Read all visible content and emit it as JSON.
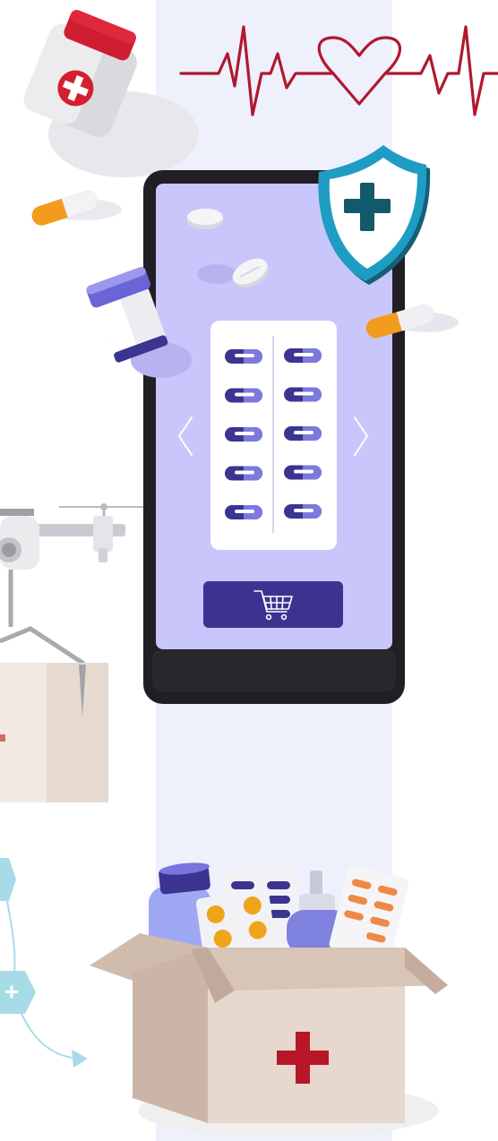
{
  "illustration": {
    "palette": {
      "background": "#ffffff",
      "column": "#eef0fc",
      "phone_body": "#211f23",
      "screen": "#c9c6fb",
      "pill_dark": "#3b3491",
      "pill_light": "#7c79dd",
      "cart_button": "#3c3290",
      "shield_outer": "#1f9cc4",
      "shield_cross": "#125a6b",
      "heartbeat": "#b0182e",
      "red_cross": "#b81629",
      "capsule_orange": "#f39b1f",
      "box_light": "#e6d8cd",
      "box_dark": "#cbb5a6",
      "hexagon": "#a8dbe8"
    },
    "icons": [
      "pill-jar-icon",
      "heartbeat-line-icon",
      "heart-icon",
      "shield-plus-icon",
      "capsule-icon",
      "tablet-icon",
      "pill-bottle-icon",
      "blister-pack-icon",
      "chevron-left-icon",
      "chevron-right-icon",
      "shopping-cart-icon",
      "drone-icon",
      "parcel-box-icon",
      "hexagon-plus-icon",
      "medicine-box-icon",
      "dropper-bottle-icon"
    ]
  }
}
